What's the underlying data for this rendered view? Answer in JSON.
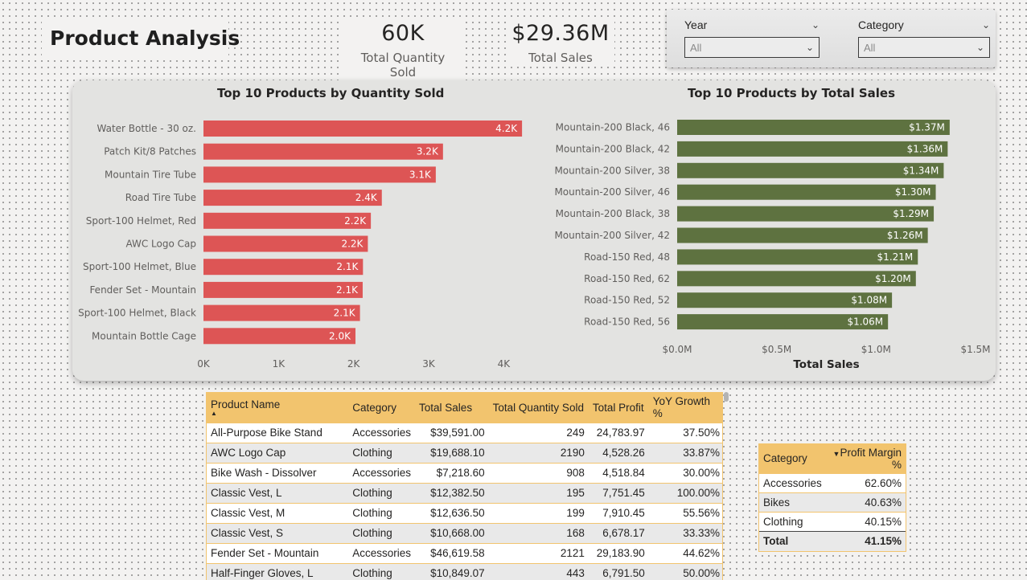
{
  "page": {
    "title": "Product Analysis"
  },
  "kpis": [
    {
      "value": "60K",
      "label": "Total Quantity Sold"
    },
    {
      "value": "$29.36M",
      "label": "Total Sales"
    }
  ],
  "slicers": [
    {
      "label": "Year",
      "value": "All"
    },
    {
      "label": "Category",
      "value": "All"
    }
  ],
  "chart_data": [
    {
      "type": "bar",
      "orientation": "horizontal",
      "title": "Top 10 Products by Quantity Sold",
      "xlabel": "",
      "ylabel": "",
      "color": "#dd5555",
      "xlim": [
        0,
        4500
      ],
      "x_ticks": [
        {
          "value": 0,
          "label": "0K"
        },
        {
          "value": 1000,
          "label": "1K"
        },
        {
          "value": 2000,
          "label": "2K"
        },
        {
          "value": 3000,
          "label": "3K"
        },
        {
          "value": 4000,
          "label": "4K"
        }
      ],
      "categories": [
        "Water Bottle - 30 oz.",
        "Patch Kit/8 Patches",
        "Mountain Tire Tube",
        "Road Tire Tube",
        "Sport-100 Helmet, Red",
        "AWC Logo Cap",
        "Sport-100 Helmet, Blue",
        "Fender Set - Mountain",
        "Sport-100 Helmet, Black",
        "Mountain Bottle Cage"
      ],
      "values": [
        4244,
        3191,
        3095,
        2376,
        2230,
        2190,
        2125,
        2121,
        2085,
        2025
      ],
      "data_labels": [
        "4.2K",
        "3.2K",
        "3.1K",
        "2.4K",
        "2.2K",
        "2.2K",
        "2.1K",
        "2.1K",
        "2.1K",
        "2.0K"
      ],
      "grid": false
    },
    {
      "type": "bar",
      "orientation": "horizontal",
      "title": "Top 10 Products by Total Sales",
      "xlabel": "Total Sales",
      "ylabel": "",
      "color": "#5e7240",
      "xlim": [
        0,
        1.5
      ],
      "x_ticks": [
        {
          "value": 0,
          "label": "$0.0M"
        },
        {
          "value": 0.5,
          "label": "$0.5M"
        },
        {
          "value": 1.0,
          "label": "$1.0M"
        },
        {
          "value": 1.5,
          "label": "$1.5M"
        }
      ],
      "categories": [
        "Mountain-200 Black, 46",
        "Mountain-200 Black, 42",
        "Mountain-200 Silver, 38",
        "Mountain-200 Silver, 46",
        "Mountain-200 Black, 38",
        "Mountain-200 Silver, 42",
        "Road-150 Red, 48",
        "Road-150 Red, 62",
        "Road-150 Red, 52",
        "Road-150 Red, 56"
      ],
      "values": [
        1.37,
        1.36,
        1.34,
        1.3,
        1.29,
        1.26,
        1.21,
        1.2,
        1.08,
        1.06
      ],
      "data_labels": [
        "$1.37M",
        "$1.36M",
        "$1.34M",
        "$1.30M",
        "$1.29M",
        "$1.26M",
        "$1.21M",
        "$1.20M",
        "$1.08M",
        "$1.06M"
      ],
      "grid": false
    }
  ],
  "product_table": {
    "columns": [
      "Product Name",
      "Category",
      "Total Sales",
      "Total Quantity Sold",
      "Total Profit",
      "YoY Growth %"
    ],
    "rows": [
      [
        "All-Purpose Bike Stand",
        "Accessories",
        "$39,591.00",
        "249",
        "24,783.97",
        "37.50%"
      ],
      [
        "AWC Logo Cap",
        "Clothing",
        "$19,688.10",
        "2190",
        "4,528.26",
        "33.87%"
      ],
      [
        "Bike Wash - Dissolver",
        "Accessories",
        "$7,218.60",
        "908",
        "4,518.84",
        "30.00%"
      ],
      [
        "Classic Vest, L",
        "Clothing",
        "$12,382.50",
        "195",
        "7,751.45",
        "100.00%"
      ],
      [
        "Classic Vest, M",
        "Clothing",
        "$12,636.50",
        "199",
        "7,910.45",
        "55.56%"
      ],
      [
        "Classic Vest, S",
        "Clothing",
        "$10,668.00",
        "168",
        "6,678.17",
        "33.33%"
      ],
      [
        "Fender Set - Mountain",
        "Accessories",
        "$46,619.58",
        "2121",
        "29,183.90",
        "44.62%"
      ],
      [
        "Half-Finger Gloves, L",
        "Clothing",
        "$10,849.07",
        "443",
        "6,791.50",
        "50.00%"
      ]
    ]
  },
  "profit_table": {
    "columns": [
      "Category",
      "Profit Margin %"
    ],
    "rows": [
      [
        "Accessories",
        "62.60%"
      ],
      [
        "Bikes",
        "40.63%"
      ],
      [
        "Clothing",
        "40.15%"
      ]
    ],
    "total": [
      "Total",
      "41.15%"
    ]
  },
  "colors": {
    "quantity_bar": "#dd5555",
    "sales_bar": "#5e7240",
    "table_header": "#f2c46e"
  }
}
